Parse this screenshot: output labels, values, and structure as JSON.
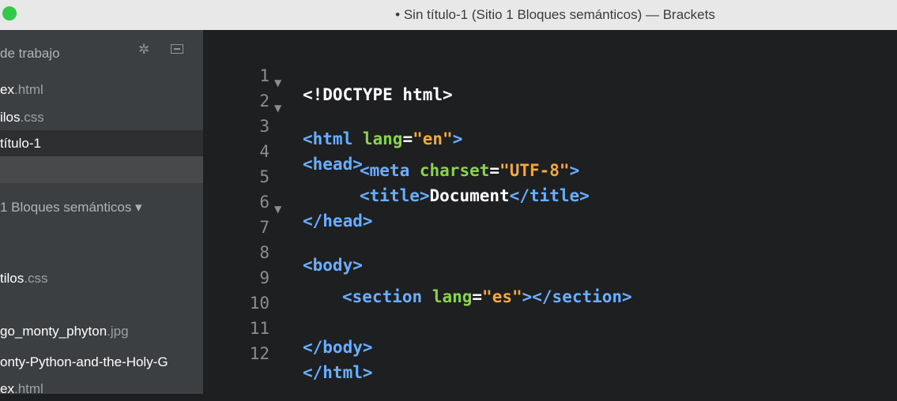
{
  "window": {
    "title": "• Sin título-1 (Sitio 1 Bloques semánticos) — Brackets"
  },
  "sidebar": {
    "working_files_header": "de trabajo",
    "working_files": [
      {
        "name": "ex",
        "ext": ".html"
      },
      {
        "name": "ilos",
        "ext": ".css"
      },
      {
        "name": "título-1",
        "ext": ""
      }
    ],
    "project_header": "1 Bloques semánticos ▾",
    "project_files": [
      {
        "name": "tilos",
        "ext": ".css"
      },
      {
        "name": "go_monty_phyton",
        "ext": ".jpg"
      },
      {
        "name": "onty-Python-and-the-Holy-G",
        "ext": ""
      },
      {
        "name": "ex",
        "ext": ".html"
      }
    ]
  },
  "editor": {
    "lines": [
      {
        "num": "1",
        "fold": ""
      },
      {
        "num": "2",
        "fold": "▼"
      },
      {
        "num": "3",
        "fold": "▼"
      },
      {
        "num": "4",
        "fold": ""
      },
      {
        "num": "5",
        "fold": ""
      },
      {
        "num": "6",
        "fold": ""
      },
      {
        "num": "7",
        "fold": "▼"
      },
      {
        "num": "8",
        "fold": ""
      },
      {
        "num": "9",
        "fold": ""
      },
      {
        "num": "10",
        "fold": ""
      },
      {
        "num": "11",
        "fold": ""
      },
      {
        "num": "12",
        "fold": ""
      }
    ],
    "code": {
      "l1_doctype": "<!DOCTYPE html>",
      "l2_open": "<html",
      "l2_attr": "lang",
      "l2_eq": "=",
      "l2_val": "\"en\"",
      "l2_close": ">",
      "l3": "<head>",
      "l4_open": "<meta",
      "l4_attr": "charset",
      "l4_eq": "=",
      "l4_val": "\"UTF-8\"",
      "l4_close": ">",
      "l5_open": "<title>",
      "l5_text": "Document",
      "l5_close": "</title>",
      "l6": "</head>",
      "l7": "<body>",
      "l9_open": "<section",
      "l9_attr": "lang",
      "l9_eq": "=",
      "l9_val": "\"es\"",
      "l9_close": "></section>",
      "l11": "</body>",
      "l12": "</html>"
    }
  }
}
